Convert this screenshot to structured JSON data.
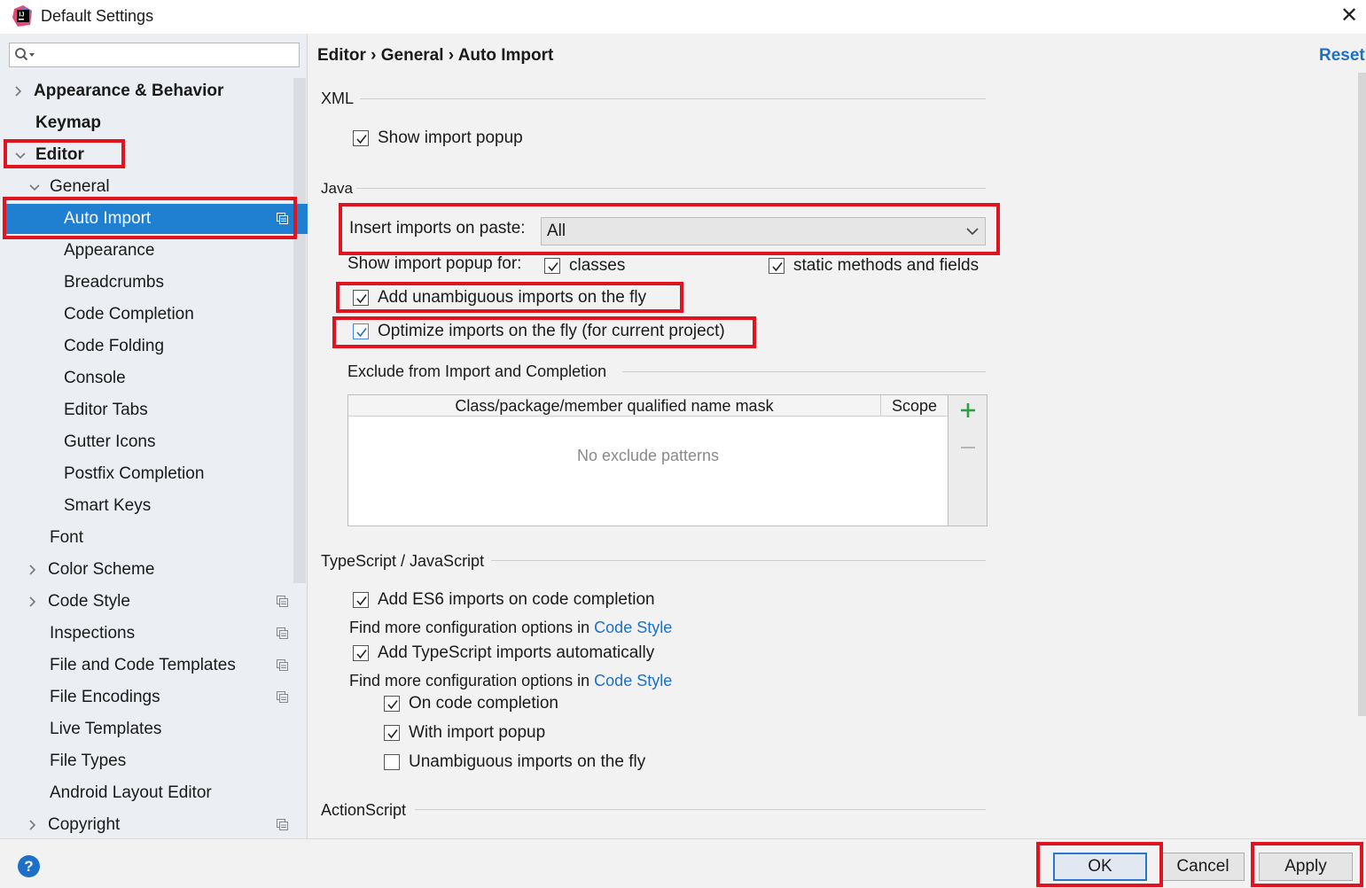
{
  "window": {
    "title": "Default Settings",
    "close_glyph": "✕",
    "app_icon": "intellij-logo-icon"
  },
  "colors": {
    "selection": "#1f7fd0",
    "link": "#1d6fc7",
    "highlight": "#e0141e",
    "add_green": "#2ea043"
  },
  "sidebar": {
    "search": {
      "value": "",
      "placeholder": ""
    },
    "items": [
      {
        "label": "Appearance & Behavior",
        "expanded": false
      },
      {
        "label": "Keymap"
      },
      {
        "label": "Editor",
        "expanded": true
      },
      {
        "label": "General",
        "expanded": true
      },
      {
        "label": "Auto Import",
        "selected": true
      },
      {
        "label": "Appearance"
      },
      {
        "label": "Breadcrumbs"
      },
      {
        "label": "Code Completion"
      },
      {
        "label": "Code Folding"
      },
      {
        "label": "Console"
      },
      {
        "label": "Editor Tabs"
      },
      {
        "label": "Gutter Icons"
      },
      {
        "label": "Postfix Completion"
      },
      {
        "label": "Smart Keys"
      },
      {
        "label": "Font"
      },
      {
        "label": "Color Scheme",
        "expanded": false
      },
      {
        "label": "Code Style",
        "expanded": false
      },
      {
        "label": "Inspections"
      },
      {
        "label": "File and Code Templates"
      },
      {
        "label": "File Encodings"
      },
      {
        "label": "Live Templates"
      },
      {
        "label": "File Types"
      },
      {
        "label": "Android Layout Editor"
      },
      {
        "label": "Copyright",
        "expanded": false
      }
    ]
  },
  "main": {
    "breadcrumb": "Editor › General › Auto Import",
    "reset_label": "Reset",
    "xml": {
      "title": "XML",
      "show_import_popup": {
        "label": "Show import popup",
        "checked": true
      }
    },
    "java": {
      "title": "Java",
      "insert_imports_label": "Insert imports on paste:",
      "insert_imports_value": "All",
      "popup_for_label": "Show import popup for:",
      "classes": {
        "label": "classes",
        "checked": true
      },
      "static_methods": {
        "label": "static methods and fields",
        "checked": true
      },
      "add_unambiguous": {
        "label": "Add unambiguous imports on the fly",
        "checked": true
      },
      "optimize_imports": {
        "label": "Optimize imports on the fly (for current project)",
        "checked": true
      },
      "exclude_title": "Exclude from Import and Completion",
      "table": {
        "columns": [
          "Class/package/member qualified name mask",
          "Scope"
        ],
        "empty_text": "No exclude patterns"
      }
    },
    "typescript": {
      "title": "TypeScript / JavaScript",
      "add_es6": {
        "label": "Add ES6 imports on code completion",
        "checked": true
      },
      "info1_prefix": "Find more configuration options in",
      "info1_link": "Code Style",
      "add_ts": {
        "label": "Add TypeScript imports automatically",
        "checked": true
      },
      "info2_prefix": "Find more configuration options in",
      "info2_link": "Code Style",
      "on_completion": {
        "label": "On code completion",
        "checked": true
      },
      "with_popup": {
        "label": "With import popup",
        "checked": true
      },
      "unambiguous": {
        "label": "Unambiguous imports on the fly",
        "checked": false
      }
    },
    "actionscript": {
      "title": "ActionScript"
    }
  },
  "footer": {
    "help_label": "?",
    "ok_label": "OK",
    "cancel_label": "Cancel",
    "apply_label": "Apply"
  }
}
